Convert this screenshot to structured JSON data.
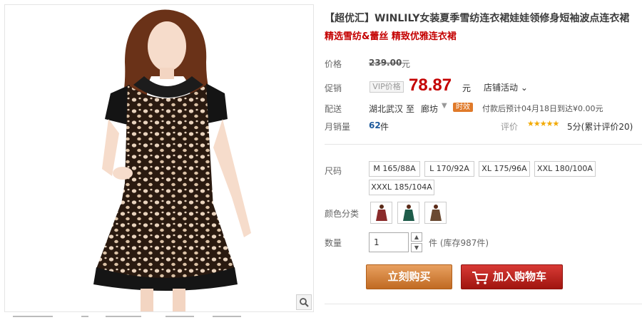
{
  "product": {
    "title": "【超优汇】WINLILY女装夏季雪纺连衣裙娃娃领修身短袖波点连衣裙",
    "subtitle": "精选雪纺&蕾丝 精致优雅连衣裙"
  },
  "price": {
    "label": "价格",
    "original": "239.00",
    "unit": "元"
  },
  "promo": {
    "label": "促销",
    "vip_tag": "VIP价格",
    "price": "78.87",
    "unit": "元",
    "store_event": "店铺活动"
  },
  "shipping": {
    "label": "配送",
    "from": "湖北武汉",
    "to_word": "至",
    "destination": "廊坊",
    "badge": "时效",
    "note": "付款后预计04月18日到达¥0.00元"
  },
  "sales": {
    "label": "月销量",
    "count": "62",
    "unit": "件",
    "rating_label": "评价",
    "stars": "★★★★★",
    "rating_text": "5分(累计评价20)"
  },
  "sizes": {
    "label": "尺码",
    "options": [
      "M 165/88A",
      "L 170/92A",
      "XL 175/96A",
      "XXL 180/100A",
      "XXXL 185/104A"
    ]
  },
  "colors": {
    "label": "颜色分类",
    "swatches": [
      "#8a2b2b",
      "#1f5c4a",
      "#6b4a32"
    ]
  },
  "quantity": {
    "label": "数量",
    "value": "1",
    "stock": "件 (库存987件)"
  },
  "actions": {
    "buy": "立刻购买",
    "cart": "加入购物车"
  },
  "icons": {
    "zoom": "magnifier-icon",
    "cart": "cart-icon"
  },
  "colors_theme": {
    "accent_red": "#c40000",
    "buy_orange": "#d08040",
    "cart_red": "#b8201b"
  }
}
